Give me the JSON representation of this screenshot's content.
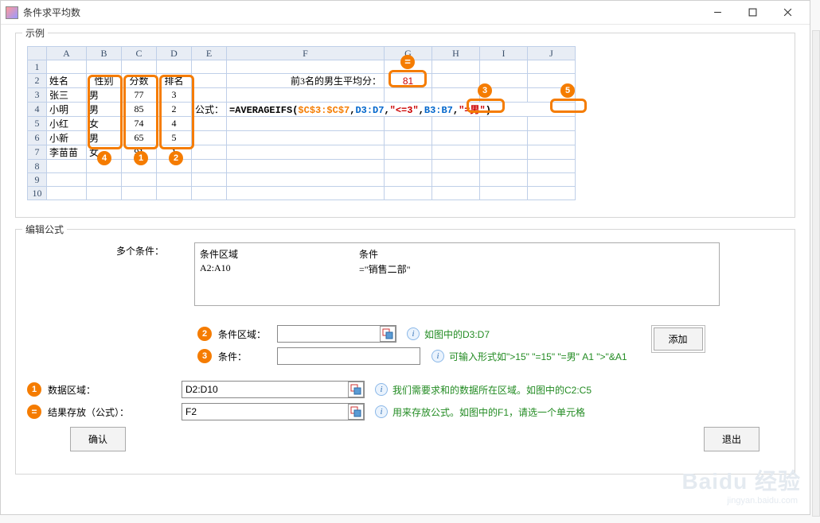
{
  "window": {
    "title": "条件求平均数"
  },
  "example": {
    "legend": "示例",
    "columns": [
      "A",
      "B",
      "C",
      "D",
      "E",
      "F",
      "G",
      "H",
      "I",
      "J"
    ],
    "headers_row": {
      "A": "姓名",
      "B": "性别",
      "C": "分数",
      "D": "排名"
    },
    "rows": [
      {
        "A": "张三",
        "B": "男",
        "C": "77",
        "D": "3"
      },
      {
        "A": "小明",
        "B": "男",
        "C": "85",
        "D": "2"
      },
      {
        "A": "小红",
        "B": "女",
        "C": "74",
        "D": "4"
      },
      {
        "A": "小新",
        "B": "男",
        "C": "65",
        "D": "5"
      },
      {
        "A": "李苗苗",
        "B": "女",
        "C": "91",
        "D": "1"
      }
    ],
    "top_label": "前3名的男生平均分：",
    "top_result": "81",
    "formula_label": "公式：",
    "formula": {
      "prefix": "=AVERAGEIFS(",
      "p1": "$C$3:$C$7",
      "p2": "D3:D7",
      "p3": "\"<=3\"",
      "p4": "B3:B7",
      "p5": "\"=男\"",
      "suffix": ")"
    },
    "badges": {
      "1": "1",
      "2": "2",
      "3": "3",
      "4": "4",
      "5": "5",
      "eq": "="
    }
  },
  "edit": {
    "legend": "编辑公式",
    "multi_cond_label": "多个条件：",
    "listbox": {
      "headers": {
        "range": "条件区域",
        "cond": "条件"
      },
      "rows": [
        {
          "range": "A2:A10",
          "cond": "=\"销售二部\""
        }
      ]
    },
    "cond_range_label": "条件区域：",
    "cond_range_value": "",
    "cond_range_hint": "如图中的D3:D7",
    "cond_label": "条件：",
    "cond_value": "",
    "cond_hint": "可输入形式如\">15\" \"=15\" \"=男\"  A1 \">\"&A1",
    "add_btn": "添加",
    "data_range_label": "数据区域：",
    "data_range_value": "D2:D10",
    "data_range_hint": "我们需要求和的数据所在区域。如图中的C2:C5",
    "result_label": "结果存放（公式）：",
    "result_value": "F2",
    "result_hint": "用来存放公式。如图中的F1，请选一个单元格",
    "confirm": "确认",
    "exit": "退出"
  },
  "watermark": {
    "main": "Baidu 经验",
    "sub": "jingyan.baidu.com"
  }
}
